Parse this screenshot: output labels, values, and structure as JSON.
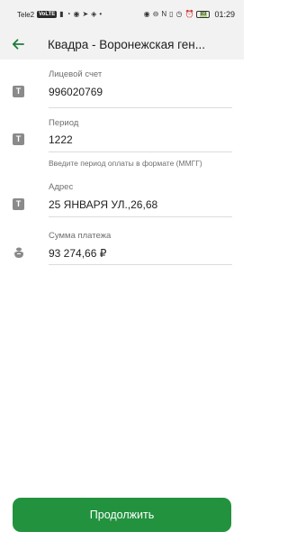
{
  "statusbar": {
    "carrier": "Tele2",
    "network_badge": "VoLTE",
    "battery": "83",
    "time": "01:29"
  },
  "header": {
    "back_icon": "arrow-left-icon",
    "title": "Квадра - Воронежская ген..."
  },
  "fields": {
    "account": {
      "label": "Лицевой счет",
      "value": "996020769"
    },
    "period": {
      "label": "Период",
      "value": "1222",
      "hint": "Введите период оплаты в формате (ММГГ)"
    },
    "address": {
      "label": "Адрес",
      "value": "25 ЯНВАРЯ УЛ.,26,68"
    },
    "amount": {
      "label": "Сумма платежа",
      "value": "93 274,66 ₽"
    }
  },
  "actions": {
    "continue_label": "Продолжить"
  },
  "colors": {
    "accent": "#22923f",
    "back_arrow": "#1c7c3a",
    "header_bg": "#f2f2f2"
  }
}
